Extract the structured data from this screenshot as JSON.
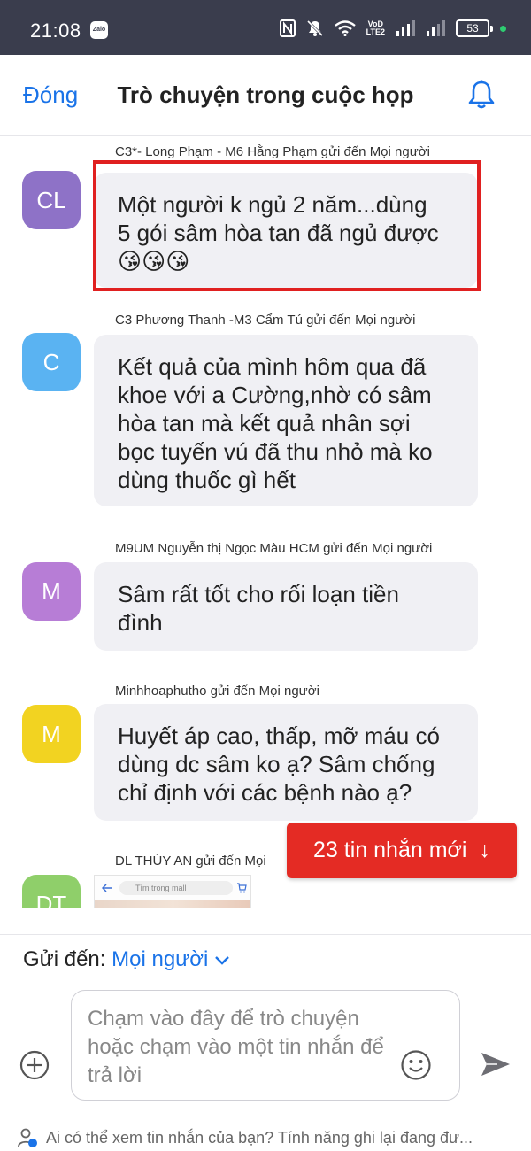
{
  "status_bar": {
    "time": "21:08",
    "zalo_badge": "Zalo",
    "network_label_top": "VoD",
    "network_label_bottom": "LTE2",
    "battery": "53",
    "icons": [
      "nfc-icon",
      "mute-icon",
      "wifi-icon",
      "signal-icon",
      "battery-icon"
    ]
  },
  "header": {
    "close_label": "Đóng",
    "title": "Trò chuyện trong cuộc họp",
    "bell_icon": "bell-icon"
  },
  "messages": [
    {
      "sender": "C3*- Long Phạm - M6 Hằng Phạm gửi  đến Mọi người",
      "avatar": "CL",
      "avatar_color": "#8e72c7",
      "lines": [
        "Một người k ngủ 2 năm...dùng",
        "5 gói sâm hòa tan đã ngủ được",
        "😘😘😘"
      ],
      "highlighted": true
    },
    {
      "sender": "C3 Phương Thanh -M3 Cẩm Tú gửi  đến Mọi người",
      "avatar": "C",
      "avatar_color": "#5ab3f2",
      "lines": [
        "Kết quả của mình hôm qua đã",
        "khoe với a Cường,nhờ có sâm",
        "hòa tan mà kết quả nhân sợi",
        "bọc tuyến vú đã thu nhỏ mà ko",
        "dùng thuốc gì hết"
      ]
    },
    {
      "sender": "M9UM Nguyễn thị Ngọc Màu HCM gửi  đến Mọi người",
      "avatar": "M",
      "avatar_color": "#b77dd6",
      "lines": [
        "Sâm rất tốt cho rối loạn tiền",
        "đình"
      ]
    },
    {
      "sender": "Minhhoaphutho gửi  đến Mọi người",
      "avatar": "M",
      "avatar_color": "#f2d321",
      "lines": [
        "Huyết áp cao, thấp, mỡ máu có",
        "dùng dc sâm ko ạ? Sâm chống",
        "chỉ định với các bệnh nào ạ?"
      ]
    },
    {
      "sender": "DL THÚY AN gửi  đến Mọi",
      "avatar": "DT",
      "avatar_color": "#8fcf6a",
      "thumbnail_search_placeholder": "Tìm trong mall"
    }
  ],
  "new_messages_button": {
    "label": "23 tin nhắn mới",
    "arrow": "↓"
  },
  "composer": {
    "send_to_label": "Gửi đến:",
    "send_to_value": "Mọi người",
    "input_placeholder": "Chạm vào đây để trò chuyện hoặc chạm vào một tin nhắn để trả lời",
    "privacy_notice": "Ai có thể xem tin nhắn của bạn? Tính năng ghi lại đang đư..."
  },
  "colors": {
    "accent": "#1a73e8",
    "status_bar_bg": "#3a3d4d",
    "bubble_bg": "#f0f0f4",
    "highlight": "#e02020",
    "new_messages_bg": "#e42b24"
  }
}
